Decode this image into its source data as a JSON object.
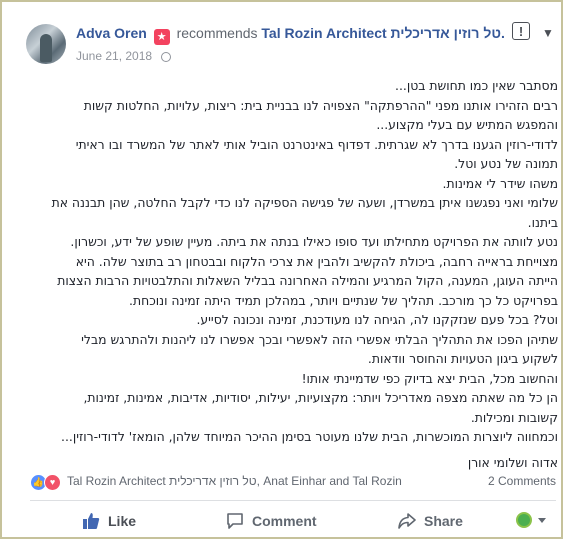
{
  "post": {
    "author": "Adva Oren",
    "badge_icon": "recommendation-star-icon",
    "action_text": "recommends",
    "page_name": "Tal Rozin Architect טל רוזין אדריכלית.",
    "date": "June 21, 2018",
    "privacy_icon": "globe-icon"
  },
  "body_lines": [
    "מסתבר שאין כמו תחושת בטן...",
    "רבים הזהירו אותנו מפני \"ההרפתקה\" הצפויה לנו בבניית בית: ריצות, עלויות, החלטות קשות",
    "והמפגש המתיש עם בעלי מקצוע...",
    "לדודי-רוזין הגענו בדרך לא שגרתית. דפדוף באינטרנט הוביל אותי לאתר של המשרד ובו ראיתי",
    "תמונה של נטע וטל.",
    "משהו שידר לי אמינות.",
    "שלומי ואני נפגשנו איתן במשרדן, ושעה של פגישה הספיקה לנו כדי לקבל החלטה, שהן תבננה את",
    "ביתנו.",
    "נטע לוותה את הפרויקט מתחילתו ועד סופו כאילו בנתה את ביתה. מעיין שופע של ידע, וכשרון.",
    "מצוייחת בראייה רחבה, ביכולת להקשיב ולהבין את צרכי הלקוח ובבטחון רב בתוצר שלה. היא",
    "הייתה העוגן, המענה, הקול המרגיע והמילה האחרונה בבליל השאלות והתלבטויות הרבות הצצות",
    "בפרויקט כל כך מורכב. תהליך של שנתיים ויותר, במהלכן תמיד היתה זמינה ונוכחת.",
    "וטל? בכל פעם שנזקקנו לה, הגיחה לנו מעודכנת, זמינה ונכונה לסייע.",
    "שתיהן הפכו את התהליך הבלתי אפשרי הזה לאפשרי ובכך אפשרו לנו ליהנות ולהתרגש מבלי",
    "לשקוע ביגון הטעויות והחוסר וודאות.",
    "והחשוב מכל, הבית יצא בדיוק כפי שדמיינתי אותו!",
    "הן כל מה שאתה מצפה מאדריכל ויותר: מקצועיות, יעילות, יסודיות, אדיבות, אמינות, זמינות,",
    "קשובות ומכילות.",
    "וכמחווה ליוצרות המוכשרות, הבית שלנו מעוטר בסימן ההיכר המיוחד שלהן, הומאז' לדודי-רוזין...",
    "",
    "אדוה ושלומי אורן"
  ],
  "reactions": {
    "icons": [
      "like-reaction-icon",
      "love-reaction-icon"
    ],
    "likers_text": "Tal Rozin Architect טל רוזין אדריכלית, Anat Einhar and Tal Rozin",
    "comments_count": "2 Comments"
  },
  "actions": {
    "like_label": "Like",
    "comment_label": "Comment",
    "share_label": "Share"
  },
  "colors": {
    "link": "#365899",
    "like_blue": "#4267b2",
    "love_red": "#f25268",
    "frame": "#c6c29b"
  }
}
